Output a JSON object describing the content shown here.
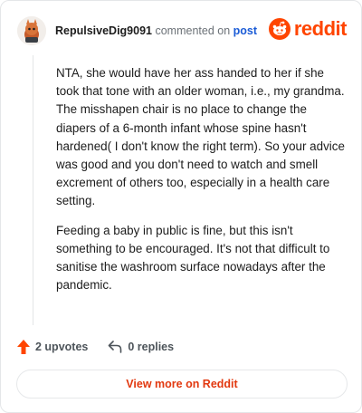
{
  "header": {
    "author": "RepulsiveDig9091",
    "action_text": "commented on",
    "target": "post",
    "logo_text": "reddit"
  },
  "comment": {
    "paragraphs": [
      "NTA, she would have her ass handed to her if she took that tone with an older woman, i.e., my grandma. The misshapen chair is no place to change the diapers of a 6-month infant whose spine hasn't hardened( I don't know the right term). So your advice was good and you don't need to watch and smell excrement of others too, especially in a health care setting.",
      "Feeding a baby in public is fine, but this isn't something to be encouraged. It's not that difficult to sanitise the washroom surface nowadays after the pandemic."
    ]
  },
  "actions": {
    "upvotes": "2 upvotes",
    "replies": "0 replies"
  },
  "footer": {
    "view_more": "View more on Reddit"
  },
  "colors": {
    "brand": "#ff4500",
    "link": "#1a5bd6",
    "upvote": "#ff4500"
  },
  "icons": {
    "avatar": "avatar-icon",
    "logo": "reddit-logo-icon",
    "upvote": "upvote-arrow-icon",
    "reply": "reply-arrow-icon"
  }
}
